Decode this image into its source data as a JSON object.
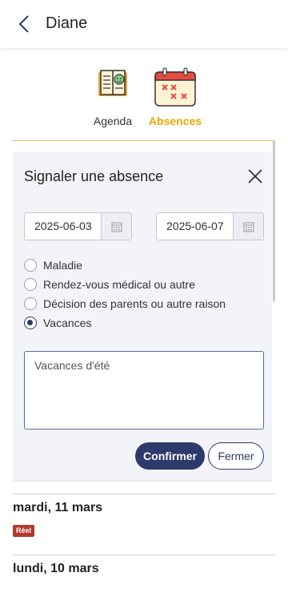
{
  "header": {
    "title": "Diane",
    "back_icon": "chevron-left-icon"
  },
  "tabs": [
    {
      "label": "Agenda",
      "icon": "notebook-smiley-icon",
      "active": false
    },
    {
      "label": "Absences",
      "icon": "calendar-cross-icon",
      "active": true
    }
  ],
  "colors": {
    "accent": "#e6a800",
    "primary": "#2d3a6b",
    "badge": "#b23a2c"
  },
  "absence_form": {
    "title": "Signaler une absence",
    "start_date": "2025-06-03",
    "end_date": "2025-06-07",
    "reasons": [
      {
        "label": "Maladie",
        "checked": false
      },
      {
        "label": "Rendez-vous médical ou autre",
        "checked": false
      },
      {
        "label": "Décision des parents ou autre raison",
        "checked": false
      },
      {
        "label": "Vacances",
        "checked": true
      }
    ],
    "comment": "Vacances d'été",
    "confirm_label": "Confirmer",
    "close_label": "Fermer"
  },
  "days": [
    {
      "date": "mardi, 11 mars",
      "badge": "Réel"
    },
    {
      "date": "lundi, 10 mars"
    }
  ]
}
